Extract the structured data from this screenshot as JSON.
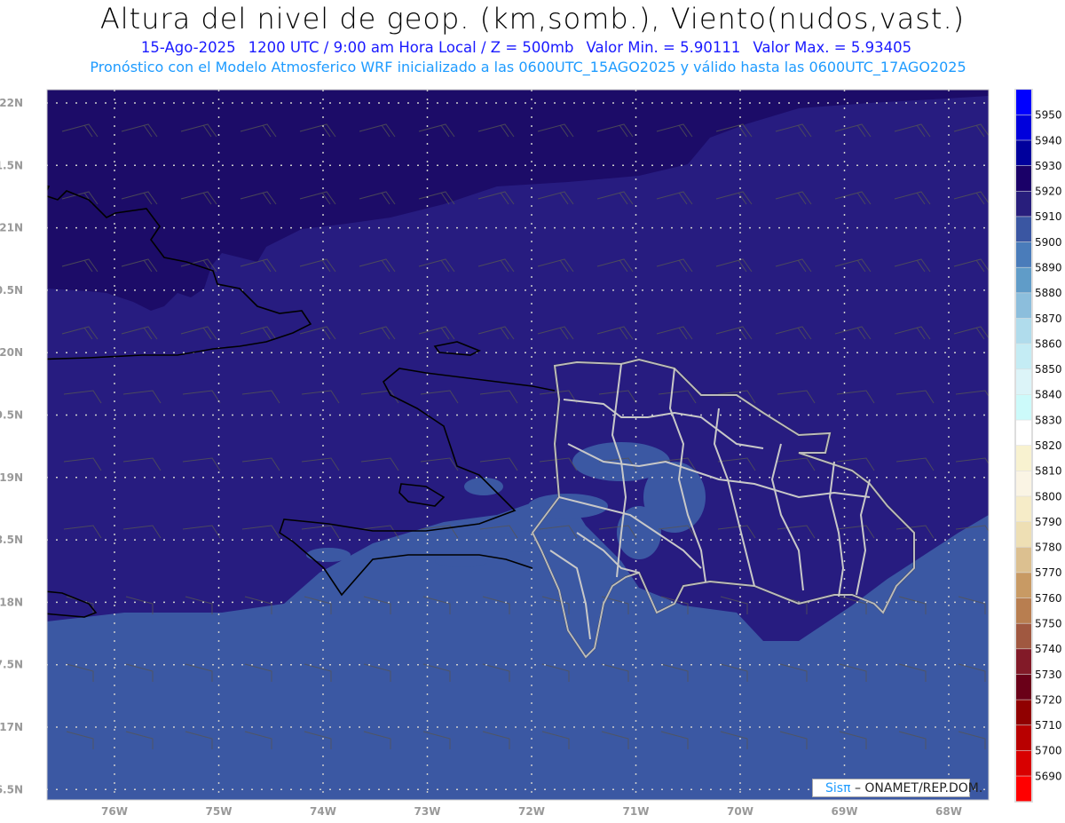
{
  "header": {
    "title": "Altura del nivel de geop. (km,somb.), Viento(nudos,vast.)",
    "date": "15-Ago-2025",
    "time": "1200 UTC / 9:00 am Hora Local / Z = 500mb",
    "min": "Valor Min. = 5.90111",
    "max": "Valor Max. = 5.93405",
    "forecast": "Pronóstico con el Modelo Atmosferico WRF inicializado a las 0600UTC_15AGO2025 y válido hasta las  0600UTC_17AGO2025"
  },
  "axes": {
    "lat_labels": [
      "22N",
      "1.5N",
      "21N",
      "0.5N",
      "20N",
      "9.5N",
      "19N",
      "8.5N",
      "18N",
      "7.5N",
      "17N",
      "6.5N"
    ],
    "lon_labels": [
      "76W",
      "75W",
      "74W",
      "73W",
      "72W",
      "71W",
      "70W",
      "69W",
      "68W"
    ]
  },
  "colorbar": {
    "labels": [
      "5950",
      "5940",
      "5930",
      "5920",
      "5910",
      "5900",
      "5890",
      "5880",
      "5870",
      "5860",
      "5850",
      "5840",
      "5830",
      "5820",
      "5810",
      "5800",
      "5790",
      "5780",
      "5770",
      "5760",
      "5750",
      "5740",
      "5730",
      "5720",
      "5710",
      "5700",
      "5690"
    ],
    "colors": [
      "#0000ff",
      "#0000dc",
      "#00009c",
      "#1a0068",
      "#281e7c",
      "#3a56a2",
      "#4a7cba",
      "#609cc8",
      "#8cbedc",
      "#b0dcec",
      "#c4ecf4",
      "#dcf4f8",
      "#ccfafa",
      "#ffffff",
      "#f8f2d0",
      "#faf4e4",
      "#f6ecc8",
      "#eedfb4",
      "#dcc090",
      "#c89a64",
      "#b87e50",
      "#a05840",
      "#821a28",
      "#6a0018",
      "#900000",
      "#b80000",
      "#d80000",
      "#ff0000"
    ]
  },
  "fill_colors": {
    "dark": "#1c0c68",
    "mid": "#271c80",
    "light": "#3b58a3"
  },
  "logo": {
    "brand": "Sisπ",
    "org": " – ONAMET/REP.DOM."
  }
}
